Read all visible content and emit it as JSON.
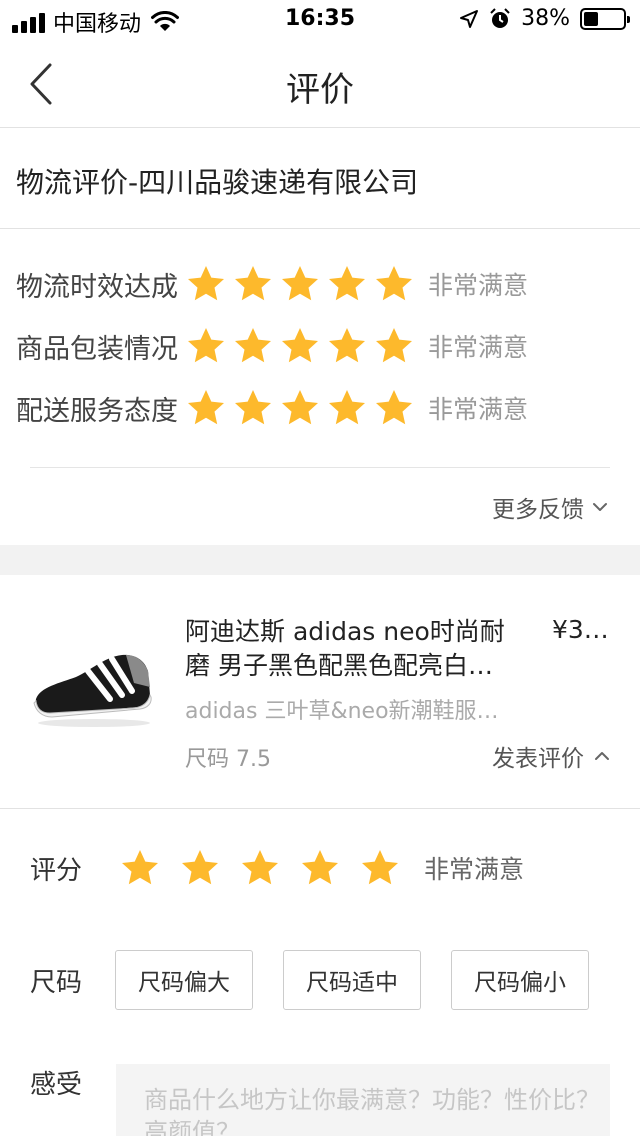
{
  "status_bar": {
    "carrier": "中国移动",
    "time": "16:35",
    "battery_percent_text": "38%",
    "battery_level": 0.38,
    "icons": [
      "signal-icon",
      "wifi-icon",
      "location-icon",
      "alarm-icon",
      "battery-icon"
    ]
  },
  "nav": {
    "title": "评价",
    "back_icon": "chevron-left-icon"
  },
  "logistics": {
    "title": "物流评价-四川品骏速递有限公司",
    "ratings": [
      {
        "label": "物流时效达成",
        "stars": 5,
        "text": "非常满意"
      },
      {
        "label": "商品包装情况",
        "stars": 5,
        "text": "非常满意"
      },
      {
        "label": "配送服务态度",
        "stars": 5,
        "text": "非常满意"
      }
    ],
    "more_feedback": "更多反馈"
  },
  "product": {
    "name_line1": "阿迪达斯 adidas neo时尚耐",
    "name_line2": "磨 男子黑色配黑色配亮白…",
    "price": "¥3…",
    "shop": "adidas 三叶草&neo新潮鞋服…",
    "size": "尺码 7.5",
    "publish_review": "发表评价"
  },
  "review_form": {
    "score_label": "评分",
    "score_stars": 5,
    "score_text": "非常满意",
    "size_label": "尺码",
    "size_options": [
      "尺码偏大",
      "尺码适中",
      "尺码偏小"
    ],
    "feel_label": "感受",
    "feel_placeholder": "商品什么地方让你最满意？功能？性价比？高颜值？"
  },
  "colors": {
    "star": "#FDB92C",
    "divider": "#E2E2E2",
    "band": "#F2F2F2"
  }
}
